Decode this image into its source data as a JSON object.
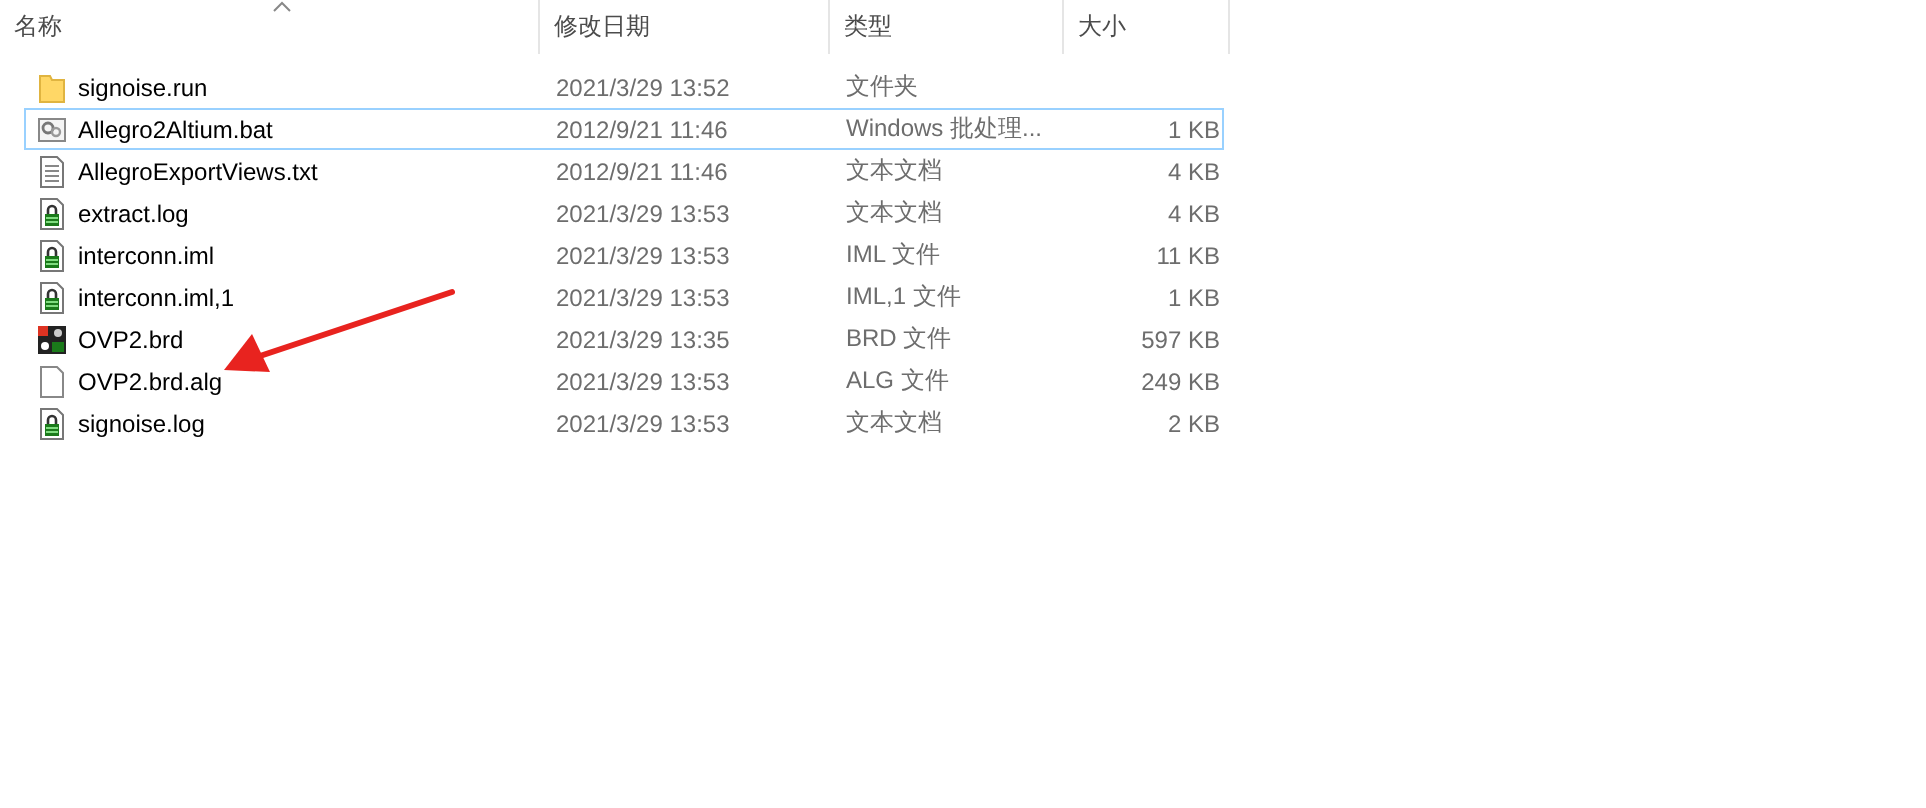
{
  "columns": [
    {
      "label": "名称",
      "sorted": true
    },
    {
      "label": "修改日期",
      "sorted": false
    },
    {
      "label": "类型",
      "sorted": false
    },
    {
      "label": "大小",
      "sorted": false
    }
  ],
  "files": [
    {
      "name": "signoise.run",
      "modified": "2021/3/29 13:52",
      "type": "文件夹",
      "kind": "folder",
      "focused": false
    },
    {
      "name": "Allegro2Altium.bat",
      "modified": "2012/9/21 11:46",
      "type": "Windows 批处理...",
      "size": "1 KB",
      "kind": "batch",
      "focused": true
    },
    {
      "name": "AllegroExportViews.txt",
      "modified": "2012/9/21 11:46",
      "type": "文本文档",
      "size": "4 KB",
      "kind": "text",
      "focused": false
    },
    {
      "name": "extract.log",
      "modified": "2021/3/29 13:53",
      "type": "文本文档",
      "size": "4 KB",
      "kind": "locked",
      "focused": false
    },
    {
      "name": "interconn.iml",
      "modified": "2021/3/29 13:53",
      "type": "IML 文件",
      "size": "11 KB",
      "kind": "locked",
      "focused": false
    },
    {
      "name": "interconn.iml,1",
      "modified": "2021/3/29 13:53",
      "type": "IML,1 文件",
      "size": "1 KB",
      "kind": "locked",
      "focused": false
    },
    {
      "name": "OVP2.brd",
      "modified": "2021/3/29 13:35",
      "type": "BRD 文件",
      "size": "597 KB",
      "kind": "board",
      "focused": false
    },
    {
      "name": "OVP2.brd.alg",
      "modified": "2021/3/29 13:53",
      "type": "ALG 文件",
      "size": "249 KB",
      "kind": "blank",
      "focused": false
    },
    {
      "name": "signoise.log",
      "modified": "2021/3/29 13:53",
      "type": "文本文档",
      "size": "2 KB",
      "kind": "locked",
      "focused": false
    }
  ],
  "annotation": {
    "kind": "arrow"
  }
}
